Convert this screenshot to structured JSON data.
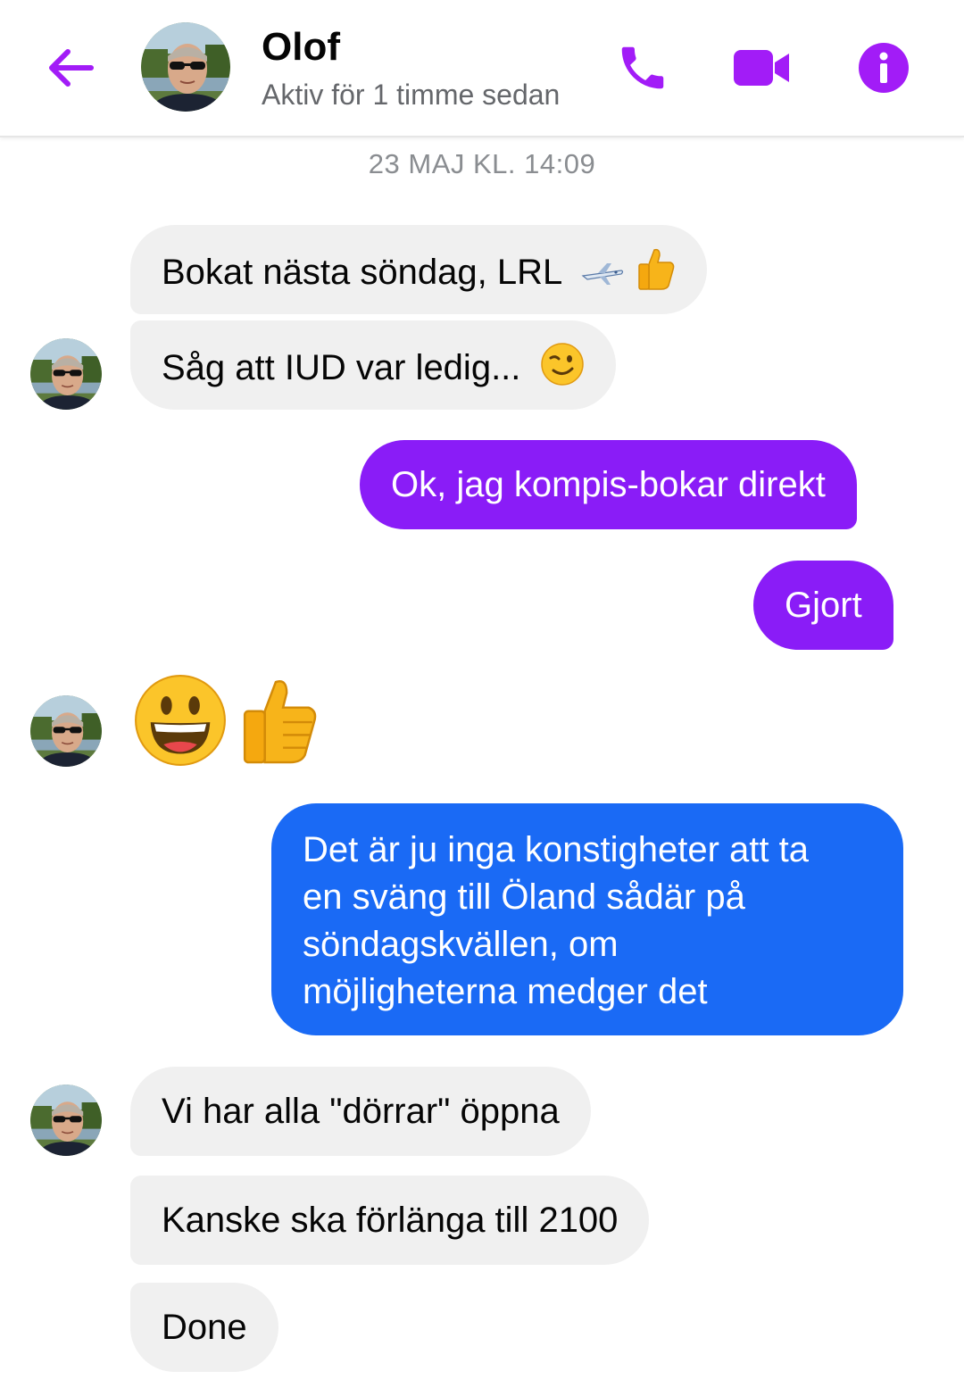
{
  "header": {
    "back_icon": "arrow-left-icon",
    "contact_name": "Olof",
    "contact_status": "Aktiv för 1 timme sedan",
    "call_icon": "phone-icon",
    "video_icon": "video-camera-icon",
    "info_icon": "info-icon",
    "accent_color": "#8a1cf7"
  },
  "conversation": {
    "timestamp": "23 MAJ KL. 14:09",
    "messages": [
      {
        "sender": "Olof",
        "direction": "incoming",
        "text": "Bokat nästa söndag, LRL",
        "emoji": [
          "airplane-emoji",
          "thumbs-up-emoji"
        ]
      },
      {
        "sender": "Olof",
        "direction": "incoming",
        "text": "Såg att IUD var ledig...",
        "emoji": [
          "winking-face-emoji"
        ]
      },
      {
        "sender": "me",
        "direction": "outgoing",
        "text": "Ok, jag kompis-bokar direkt",
        "color": "#8a1cf7"
      },
      {
        "sender": "me",
        "direction": "outgoing",
        "text": "Gjort",
        "color": "#8a1cf7"
      },
      {
        "sender": "Olof",
        "direction": "incoming",
        "text": "",
        "emoji": [
          "grinning-face-emoji",
          "thumbs-up-emoji"
        ]
      },
      {
        "sender": "me",
        "direction": "outgoing",
        "text_lines": [
          "Det är ju inga konstigheter att ta",
          "en sväng till Öland sådär på",
          "söndagskvällen, om",
          "möjligheterna medger det"
        ],
        "color": "#1a6af5"
      },
      {
        "sender": "Olof",
        "direction": "incoming",
        "text": "Vi har alla \"dörrar\" öppna"
      },
      {
        "sender": "Olof",
        "direction": "incoming",
        "text": "Kanske ska förlänga till 2100"
      },
      {
        "sender": "Olof",
        "direction": "incoming",
        "text": "Done"
      }
    ]
  },
  "colors": {
    "incoming_bubble": "#f0f0f0",
    "outgoing_purple": "#8a1cf7",
    "outgoing_blue": "#1a6af5"
  }
}
